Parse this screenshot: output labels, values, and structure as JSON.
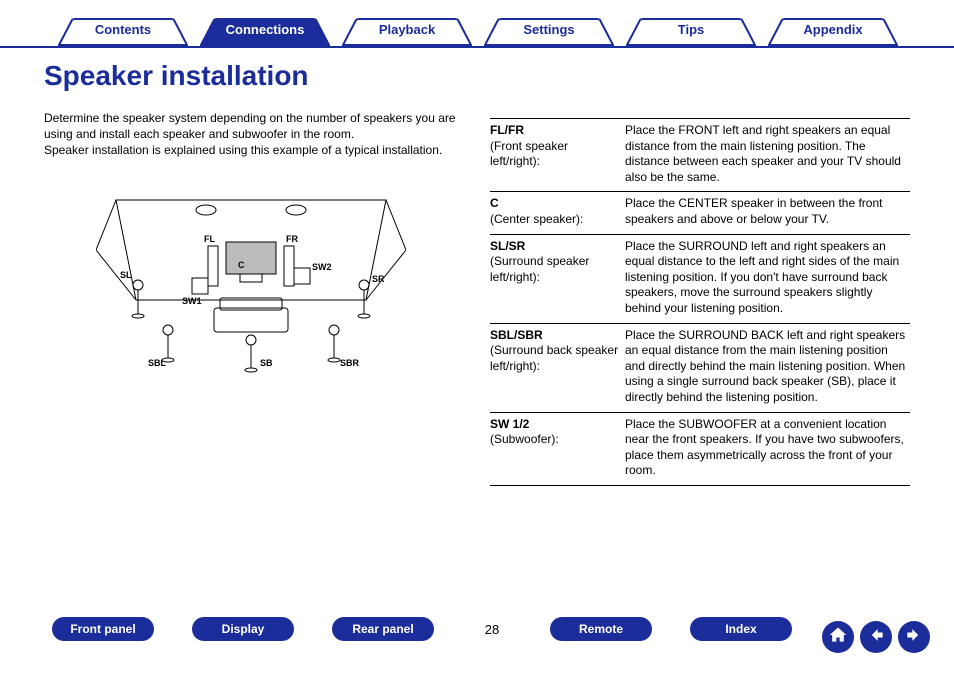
{
  "tabs": [
    {
      "label": "Contents",
      "active": false
    },
    {
      "label": "Connections",
      "active": true
    },
    {
      "label": "Playback",
      "active": false
    },
    {
      "label": "Settings",
      "active": false
    },
    {
      "label": "Tips",
      "active": false
    },
    {
      "label": "Appendix",
      "active": false
    }
  ],
  "page_title": "Speaker installation",
  "intro_para1": "Determine the speaker system depending on the number of speakers you are using and install each speaker and subwoofer in the room.",
  "intro_para2": "Speaker installation is explained using this example of a typical installation.",
  "diagram_labels": {
    "SL": "SL",
    "FL": "FL",
    "FR": "FR",
    "SR": "SR",
    "SW1": "SW1",
    "SW2": "SW2",
    "C": "C",
    "SBL": "SBL",
    "SB": "SB",
    "SBR": "SBR"
  },
  "speakers": [
    {
      "code": "FL/FR",
      "sub": "(Front speaker left/right):",
      "desc": "Place the FRONT left and right speakers an equal distance from the main listening position. The distance between each speaker and your TV should also be the same."
    },
    {
      "code": "C",
      "sub": "(Center speaker):",
      "desc": "Place the CENTER speaker in between the front speakers and above or below your TV."
    },
    {
      "code": "SL/SR",
      "sub": "(Surround speaker left/right):",
      "desc": "Place the SURROUND left and right speakers an equal distance to the left and right sides of the main listening position. If you don't have surround back speakers, move the surround speakers slightly behind your listening position."
    },
    {
      "code": "SBL/SBR",
      "sub": "(Surround back speaker left/right):",
      "desc": "Place the SURROUND BACK left and right speakers an equal distance from the main listening position and directly behind the main listening position. When using a single surround back speaker (SB), place it directly behind the listening position."
    },
    {
      "code": "SW 1/2",
      "sub": "(Subwoofer):",
      "desc": "Place the SUBWOOFER at a convenient location near the front speakers. If you have two subwoofers, place them asymmetrically across the front of your room."
    }
  ],
  "bottom_nav": [
    "Front panel",
    "Display",
    "Rear panel"
  ],
  "page_number": "28",
  "bottom_nav2": [
    "Remote",
    "Index"
  ]
}
